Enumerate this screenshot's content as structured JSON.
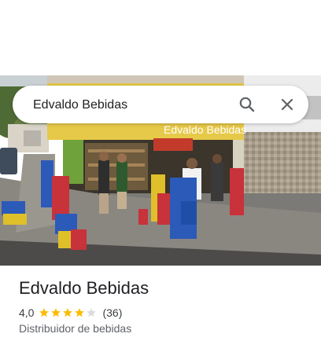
{
  "search": {
    "query": "Edvaldo Bebidas",
    "clear_label": "Clear search",
    "search_label": "Search"
  },
  "photo": {
    "storefront_sign": "Edvaldo Bebidas"
  },
  "place": {
    "name": "Edvaldo Bebidas",
    "rating": "4,0",
    "rating_value": 4.0,
    "review_count": "(36)",
    "category": "Distribuidor de bebidas"
  },
  "colors": {
    "star": "#fbbc04",
    "star_empty": "#dadce0"
  }
}
